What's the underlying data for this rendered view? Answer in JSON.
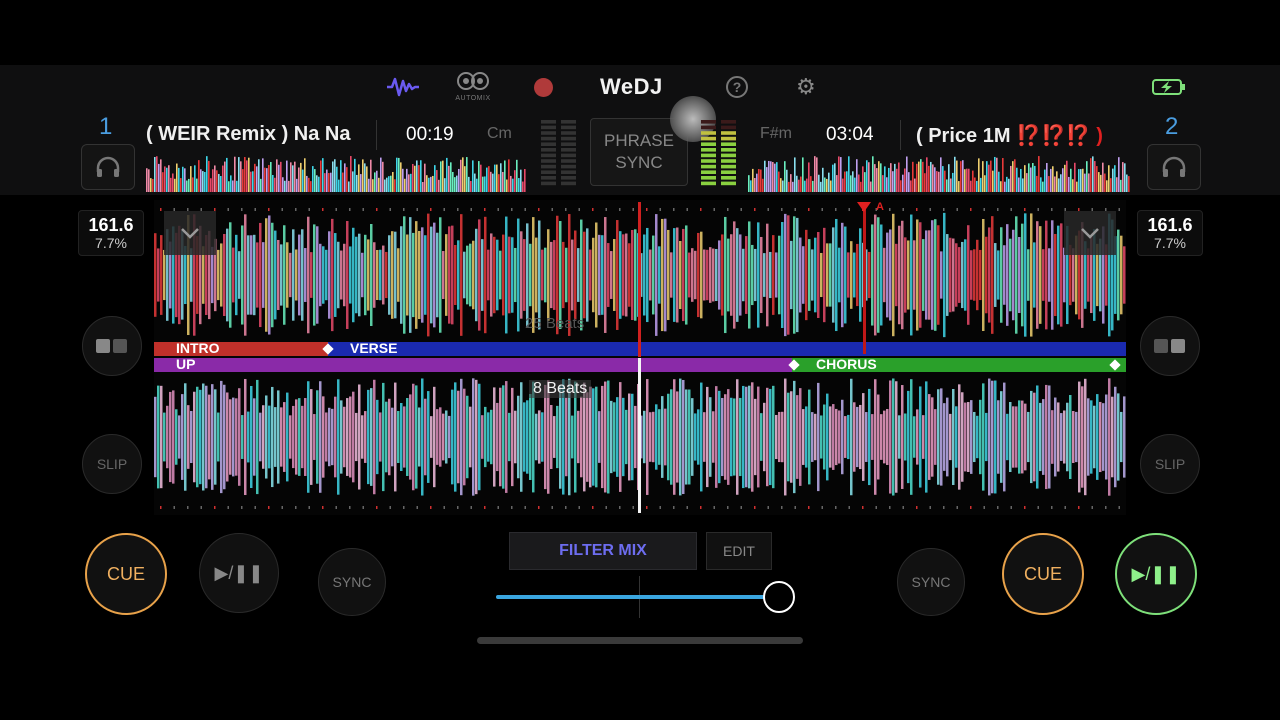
{
  "app": {
    "logo": "WeDJ",
    "automix_label": "AUTOMIX",
    "phrase_sync_label": [
      "PHRASE",
      "SYNC"
    ]
  },
  "icons": {
    "waveform": "waveform-icon",
    "automix": "automix-icon",
    "record": "record-icon",
    "help": "help-icon",
    "settings": "gear-icon",
    "battery": "battery-charging-icon"
  },
  "deck1": {
    "number": "1",
    "title": "( WEIR Remix ) Na Na",
    "time": "00:19",
    "key": "Cm",
    "bpm": "161.6",
    "pitch": "7.7%",
    "slip": "SLIP",
    "cue": "CUE",
    "sync": "SYNC",
    "play_symbol": "▶/❚❚"
  },
  "deck2": {
    "number": "2",
    "title": "( Price 1M",
    "title_emoji": "⁉️⁉️⁉️ )",
    "time": "03:04",
    "key": "F#m",
    "bpm": "161.6",
    "pitch": "7.7%",
    "slip": "SLIP",
    "cue": "CUE",
    "sync": "SYNC",
    "play_symbol": "▶/❚❚"
  },
  "waveform": {
    "upper_beats_label": "25 Beats",
    "lower_beats_label": "8 Beats",
    "phrases_deck1": [
      "INTRO",
      "VERSE"
    ],
    "phrases_deck2": [
      "UP",
      "CHORUS"
    ],
    "cue_marker": "A"
  },
  "mixer": {
    "filter_mix": "FILTER MIX",
    "edit": "EDIT",
    "crossfader_position": 0.79
  },
  "colors": {
    "accent_blue": "#4a9de0",
    "cue_orange": "#e8a24a",
    "play_green": "#7ee07a",
    "filter_purple": "#6d6df0",
    "intro_red": "#c0302a",
    "verse_blue": "#1a2ab0",
    "up_purple": "#8a2aa8",
    "chorus_green": "#2aa02a"
  }
}
